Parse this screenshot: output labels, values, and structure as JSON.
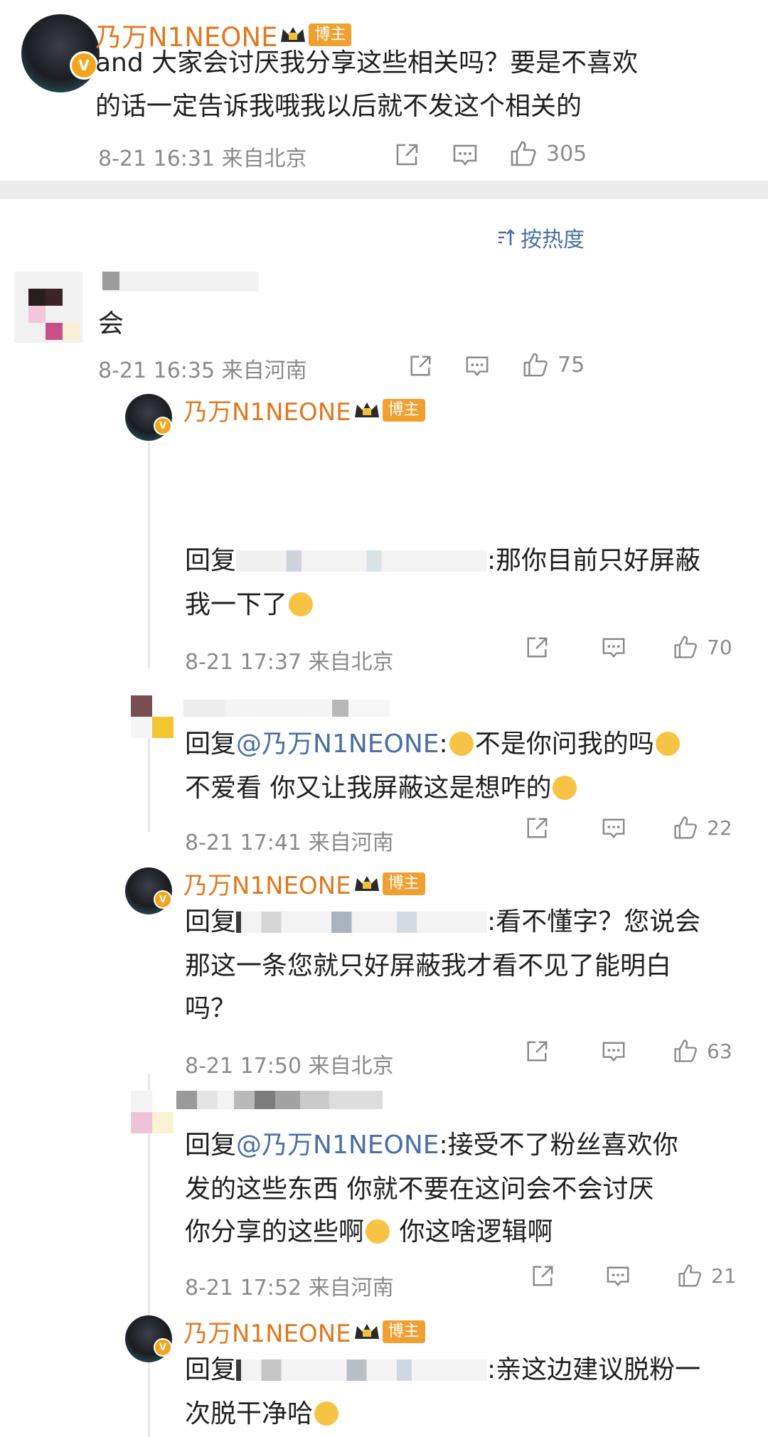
{
  "post": {
    "author": "乃万N1NEONE",
    "badge": "博主",
    "line1": "and 大家会讨厌我分享这些相关吗？要是不喜欢",
    "line2": "的话一定告诉我哦我以后就不发这个相关的",
    "time": "8-21 16:31",
    "location": "来自北京",
    "likes": "305"
  },
  "sort": {
    "label": "按热度"
  },
  "comment1": {
    "text": "会",
    "time": "8-21 16:35",
    "location": "来自河南",
    "likes": "75"
  },
  "reply1": {
    "author": "乃万N1NEONE",
    "badge": "博主",
    "prefix": "回复",
    "suffix": ":那你目前只好屏蔽",
    "line2": "我一下了",
    "time": "8-21 17:37",
    "location": "来自北京",
    "likes": "70"
  },
  "reply2": {
    "prefix": "回复",
    "mention": "@乃万N1NEONE",
    "colon": ":",
    "seg1": "不是你问我的吗",
    "line2": "不爱看 你又让我屏蔽这是想咋的",
    "time": "8-21 17:41",
    "location": "来自河南",
    "likes": "22"
  },
  "reply3": {
    "author": "乃万N1NEONE",
    "badge": "博主",
    "prefix": "回复",
    "suffix": ":看不懂字？您说会",
    "line2": "那这一条您就只好屏蔽我才看不见了能明白",
    "line3": "吗？",
    "time": "8-21 17:50",
    "location": "来自北京",
    "likes": "63"
  },
  "reply4": {
    "prefix": "回复",
    "mention": "@乃万N1NEONE",
    "suffix": ":接受不了粉丝喜欢你",
    "line2": "发的这些东西 你就不要在这问会不会讨厌",
    "line3a": "你分享的这些啊",
    "line3b": " 你这啥逻辑啊",
    "time": "8-21 17:52",
    "location": "来自河南",
    "likes": "21"
  },
  "reply5": {
    "author": "乃万N1NEONE",
    "badge": "博主",
    "prefix": "回复",
    "suffix": ":亲这边建议脱粉一",
    "line2": "次脱干净哈"
  },
  "colors": {
    "name": "#e0791f",
    "mention": "#4a6fa5",
    "meta": "#8a8a8a",
    "badge": "#f0a030"
  }
}
